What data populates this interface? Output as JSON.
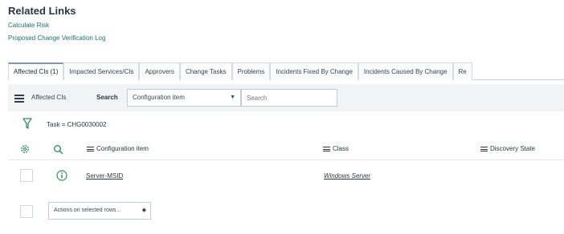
{
  "related": {
    "title": "Related Links",
    "links": [
      "Calculate Risk",
      "Proposed Change Verification Log"
    ]
  },
  "tabs": [
    "Affected CIs (1)",
    "Impacted Services/CIs",
    "Approvers",
    "Change Tasks",
    "Problems",
    "Incidents Fixed By Change",
    "Incidents Caused By Change",
    "Re"
  ],
  "toolbar": {
    "list_label": "Affected CIs",
    "search_label": "Search",
    "search_field": "Configuration item",
    "search_placeholder": "Search"
  },
  "filter": {
    "text": "Task = CHG0030002"
  },
  "columns": [
    "Configuration item",
    "Class",
    "Discovery State"
  ],
  "rows": [
    {
      "config_item": "Server-MSID",
      "class": "Windows Server"
    }
  ],
  "footer": {
    "actions_label": "Actions on selected rows..."
  },
  "colors": {
    "link": "#1e6f6a",
    "toolbar_bg": "#f1f3f4",
    "icon_green": "#2f8f5f"
  },
  "icons": [
    "filter-icon",
    "gear-icon",
    "search-icon",
    "info-icon",
    "hamburger-icon"
  ]
}
